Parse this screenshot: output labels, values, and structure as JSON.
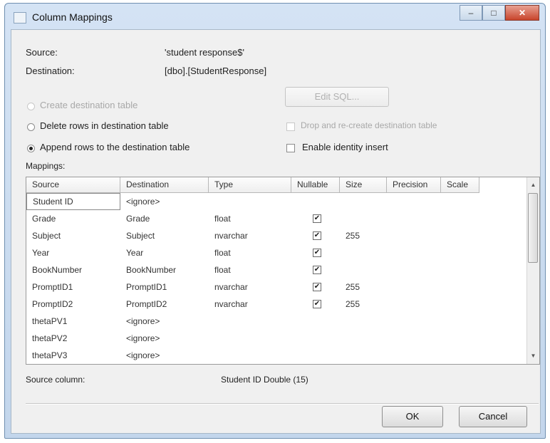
{
  "window": {
    "title": "Column Mappings",
    "minimize_glyph": "–",
    "maximize_glyph": "□",
    "close_glyph": "✕"
  },
  "info": {
    "source_label": "Source:",
    "source_value": "'student response$'",
    "destination_label": "Destination:",
    "destination_value": "[dbo].[StudentResponse]"
  },
  "options": {
    "create_table": "Create destination table",
    "edit_sql": "Edit SQL...",
    "delete_rows": "Delete rows in destination table",
    "drop_recreate": "Drop and re-create destination table",
    "append_rows": "Append rows to the destination table",
    "identity_insert": "Enable identity insert"
  },
  "mappings": {
    "label": "Mappings:",
    "columns": [
      "Source",
      "Destination",
      "Type",
      "Nullable",
      "Size",
      "Precision",
      "Scale"
    ],
    "rows": [
      {
        "source": "Student ID",
        "destination": "<ignore>",
        "type": "",
        "nullable": false,
        "size": ""
      },
      {
        "source": "Grade",
        "destination": "Grade",
        "type": "float",
        "nullable": true,
        "size": ""
      },
      {
        "source": "Subject",
        "destination": "Subject",
        "type": "nvarchar",
        "nullable": true,
        "size": "255"
      },
      {
        "source": "Year",
        "destination": "Year",
        "type": "float",
        "nullable": true,
        "size": ""
      },
      {
        "source": "BookNumber",
        "destination": "BookNumber",
        "type": "float",
        "nullable": true,
        "size": ""
      },
      {
        "source": "PromptID1",
        "destination": "PromptID1",
        "type": "nvarchar",
        "nullable": true,
        "size": "255"
      },
      {
        "source": "PromptID2",
        "destination": "PromptID2",
        "type": "nvarchar",
        "nullable": true,
        "size": "255"
      },
      {
        "source": "thetaPV1",
        "destination": "<ignore>",
        "type": "",
        "nullable": false,
        "size": ""
      },
      {
        "source": "thetaPV2",
        "destination": "<ignore>",
        "type": "",
        "nullable": false,
        "size": ""
      },
      {
        "source": "thetaPV3",
        "destination": "<ignore>",
        "type": "",
        "nullable": false,
        "size": ""
      }
    ]
  },
  "source_column": {
    "label": "Source column:",
    "value": "Student ID Double (15)"
  },
  "buttons": {
    "ok": "OK",
    "cancel": "Cancel"
  },
  "icons": {
    "check": "✔",
    "scroll_up": "▲",
    "scroll_down": "▼"
  }
}
